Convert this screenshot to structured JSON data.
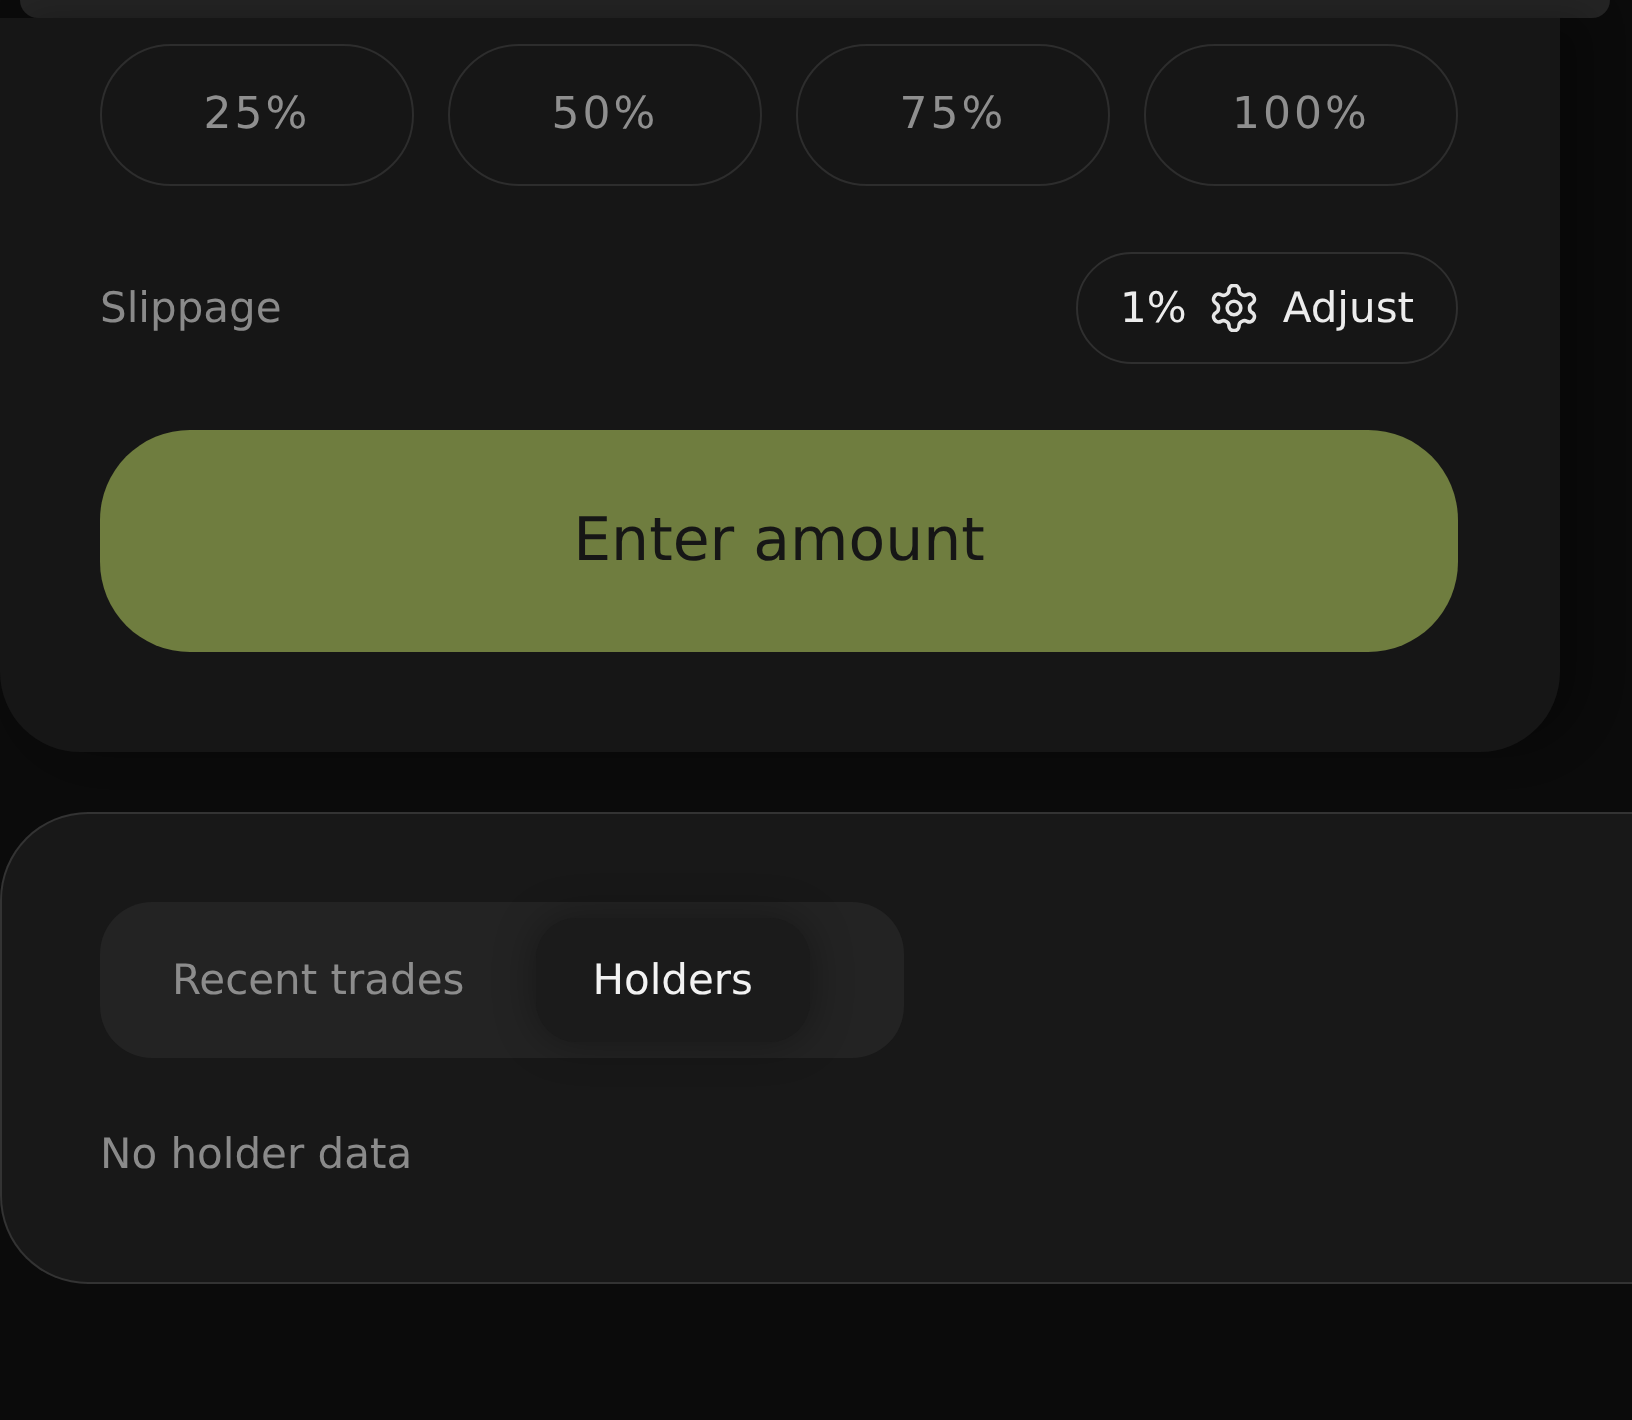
{
  "percent_options": [
    {
      "label": "25%"
    },
    {
      "label": "50%"
    },
    {
      "label": "75%"
    },
    {
      "label": "100%"
    }
  ],
  "slippage": {
    "label": "Slippage",
    "value": "1%",
    "button": "Adjust"
  },
  "submit_button": {
    "label": "Enter amount"
  },
  "holders_panel": {
    "tabs": [
      {
        "label": "Recent trades",
        "selected": false
      },
      {
        "label": "Holders",
        "selected": true
      }
    ],
    "empty_message": "No holder data"
  }
}
